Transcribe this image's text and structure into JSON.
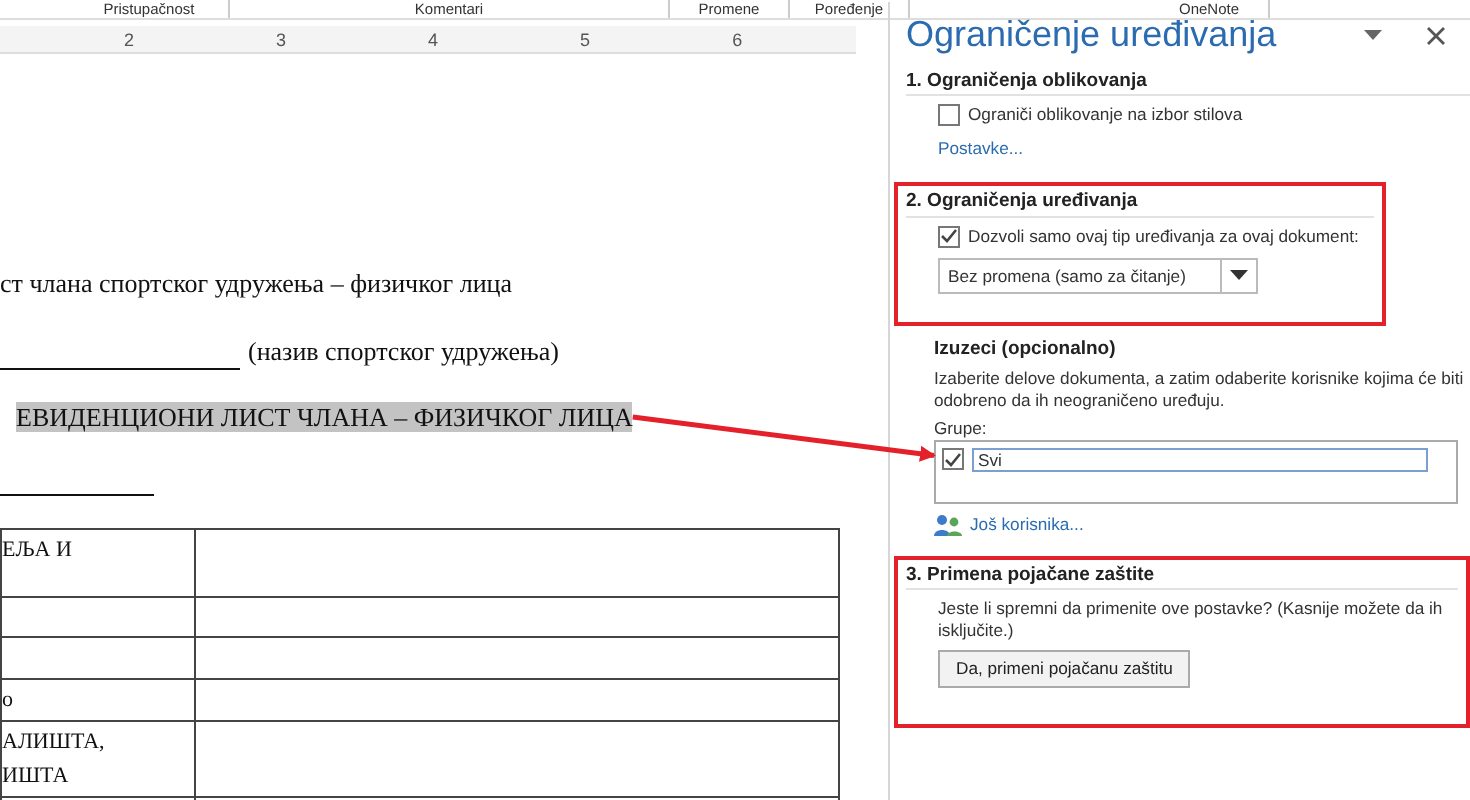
{
  "ribbon_groups": [
    {
      "label": "Pristupačnost"
    },
    {
      "label": "Komentari"
    },
    {
      "label": "Promene"
    },
    {
      "label": "Poređenje"
    },
    {
      "label": "OneNote"
    }
  ],
  "ruler": {
    "ticks": [
      "2",
      "3",
      "4",
      "5",
      "6"
    ]
  },
  "document": {
    "line_1": "ст члана спортског удружења  – физичког лица",
    "line_2": "(назив спортског удружења)",
    "heading": {
      "text": "ЕВИДЕНЦИОНИ ЛИСТ ЧЛАНА – ФИЗИЧКОГ ЛИЦА",
      "selected": true
    },
    "table_rows": [
      {
        "label": "ЕЉА И"
      },
      {},
      {},
      {
        "label": "о"
      },
      {
        "label": "АЛИШТА,\nИШТА"
      },
      {}
    ]
  },
  "pane": {
    "title": "Ograničenje uređivanja",
    "section_1": {
      "heading": "1. Ograničenja oblikovanja",
      "checkbox": {
        "label": "Ograniči oblikovanje na izbor stilova",
        "checked": false
      },
      "link": "Postavke..."
    },
    "section_2": {
      "heading": "2. Ograničenja uređivanja",
      "highlighted": true,
      "checkbox": {
        "label": "Dozvoli samo ovaj tip uređivanja za ovaj dokument:",
        "checked": true
      },
      "dropdown": {
        "value": "Bez promena (samo za čitanje)"
      }
    },
    "exceptions": {
      "heading": "Izuzeci (opcionalno)",
      "description": "Izaberite delove dokumenta, a zatim odaberite korisnike kojima će biti odobreno da ih neograničeno uređuju.",
      "groups_label": "Grupe:",
      "groups": [
        {
          "name": "Svi",
          "checked": true
        }
      ],
      "more_users_link": "Još korisnika..."
    },
    "section_3": {
      "heading": "3. Primena pojačane zaštite",
      "highlighted": true,
      "question": "Jeste li spremni da primenite ove postavke? (Kasnije možete da ih isključite.)",
      "button": "Da, primeni pojačanu zaštitu"
    }
  }
}
